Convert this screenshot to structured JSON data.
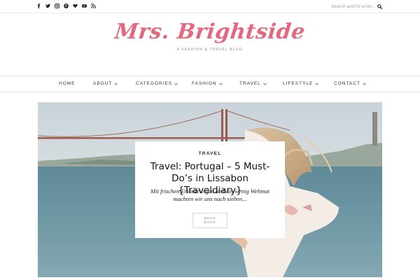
{
  "topbar": {
    "social_icons": [
      "facebook-icon",
      "twitter-icon",
      "instagram-icon",
      "pinterest-icon",
      "bloglovin-heart-icon",
      "youtube-icon",
      "rss-icon"
    ],
    "search_placeholder": "Search and hit enter..."
  },
  "header": {
    "logo_text": "Mrs. Brightside",
    "tagline": "A FASHION & TRAVEL BLOG",
    "logo_color": "#e2697e"
  },
  "nav": {
    "items": [
      {
        "label": "HOME",
        "has_dropdown": false
      },
      {
        "label": "ABOUT",
        "has_dropdown": true
      },
      {
        "label": "CATEGORIES",
        "has_dropdown": true
      },
      {
        "label": "FASHION",
        "has_dropdown": true
      },
      {
        "label": "TRAVEL",
        "has_dropdown": true
      },
      {
        "label": "LIFESTYLE",
        "has_dropdown": true
      },
      {
        "label": "CONTACT",
        "has_dropdown": true
      }
    ]
  },
  "featured": {
    "category": "TRAVEL",
    "title": "Travel: Portugal – 5 Must-Do’s in Lissabon {Traveldiary}",
    "excerpt": "Mit frischen Erinnerungen und ein wenig Wehmut machten wir uns nach sieben...",
    "read_more_line1": "READ",
    "read_more_line2": "MORE"
  }
}
